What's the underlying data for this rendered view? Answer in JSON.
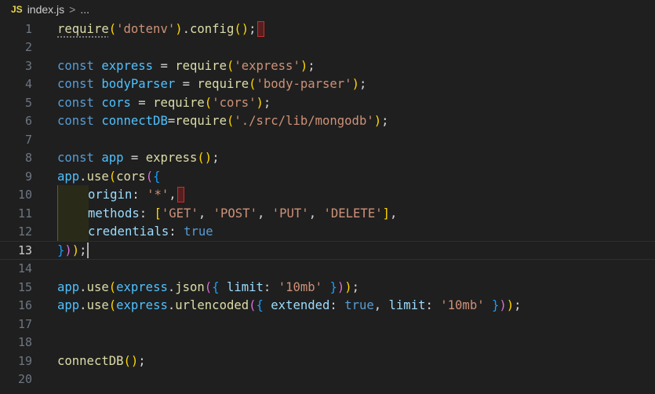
{
  "breadcrumb": {
    "file_icon": "JS",
    "filename": "index.js",
    "separator": ">",
    "ellipsis": "..."
  },
  "line_numbers": [
    "1",
    "2",
    "3",
    "4",
    "5",
    "6",
    "7",
    "8",
    "9",
    "10",
    "11",
    "12",
    "13",
    "14",
    "15",
    "16",
    "17",
    "18",
    "19",
    "20"
  ],
  "current_line": "13",
  "code": {
    "l1": {
      "fn": "require",
      "p1": "(",
      "s": "'dotenv'",
      "p2": ")",
      "dot": ".",
      "fn2": "config",
      "p3": "()",
      "semi": ";"
    },
    "l3": {
      "kw": "const",
      "v": " express ",
      "eq": "= ",
      "fn": "require",
      "p1": "(",
      "s": "'express'",
      "p2": ")",
      "semi": ";"
    },
    "l4": {
      "kw": "const",
      "v": " bodyParser ",
      "eq": "= ",
      "fn": "require",
      "p1": "(",
      "s": "'body-parser'",
      "p2": ")",
      "semi": ";"
    },
    "l5": {
      "kw": "const",
      "v": " cors ",
      "eq": "= ",
      "fn": "require",
      "p1": "(",
      "s": "'cors'",
      "p2": ")",
      "semi": ";"
    },
    "l6": {
      "kw": "const",
      "v": " connectDB",
      "eq": "=",
      "fn": "require",
      "p1": "(",
      "s": "'./src/lib/mongodb'",
      "p2": ")",
      "semi": ";"
    },
    "l8": {
      "kw": "const",
      "v": " app ",
      "eq": "= ",
      "fn": "express",
      "p1": "()",
      "semi": ";"
    },
    "l9": {
      "v": "app",
      "dot": ".",
      "fn": "use",
      "p1": "(",
      "fn2": "cors",
      "p2": "(",
      "p3": "{"
    },
    "l10": {
      "v": "origin",
      "colon": ": ",
      "s": "'*'",
      "comma": ","
    },
    "l11": {
      "v": "methods",
      "colon": ": ",
      "b1": "[",
      "s1": "'GET'",
      "c1": ", ",
      "s2": "'POST'",
      "c2": ", ",
      "s3": "'PUT'",
      "c3": ", ",
      "s4": "'DELETE'",
      "b2": "]",
      "comma": ","
    },
    "l12": {
      "v": "credentials",
      "colon": ": ",
      "kw": "true"
    },
    "l13": {
      "p3": "}",
      "p2": ")",
      "p1": ")",
      "semi": ";"
    },
    "l15": {
      "v": "app",
      "dot": ".",
      "fn": "use",
      "p1": "(",
      "v2": "express",
      "dot2": ".",
      "fn2": "json",
      "p2": "(",
      "p3": "{",
      "sp": " ",
      "v3": "limit",
      "colon": ": ",
      "s": "'10mb'",
      "sp2": " ",
      "p3c": "}",
      "p2c": ")",
      "p1c": ")",
      "semi": ";"
    },
    "l16": {
      "v": "app",
      "dot": ".",
      "fn": "use",
      "p1": "(",
      "v2": "express",
      "dot2": ".",
      "fn2": "urlencoded",
      "p2": "(",
      "p3": "{",
      "sp": " ",
      "v3": "extended",
      "colon": ": ",
      "kw": "true",
      "c": ", ",
      "v4": "limit",
      "colon2": ": ",
      "s": "'10mb'",
      "sp2": " ",
      "p3c": "}",
      "p2c": ")",
      "p1c": ")",
      "semi": ";"
    },
    "l19": {
      "fn": "connectDB",
      "p1": "()",
      "semi": ";"
    }
  }
}
